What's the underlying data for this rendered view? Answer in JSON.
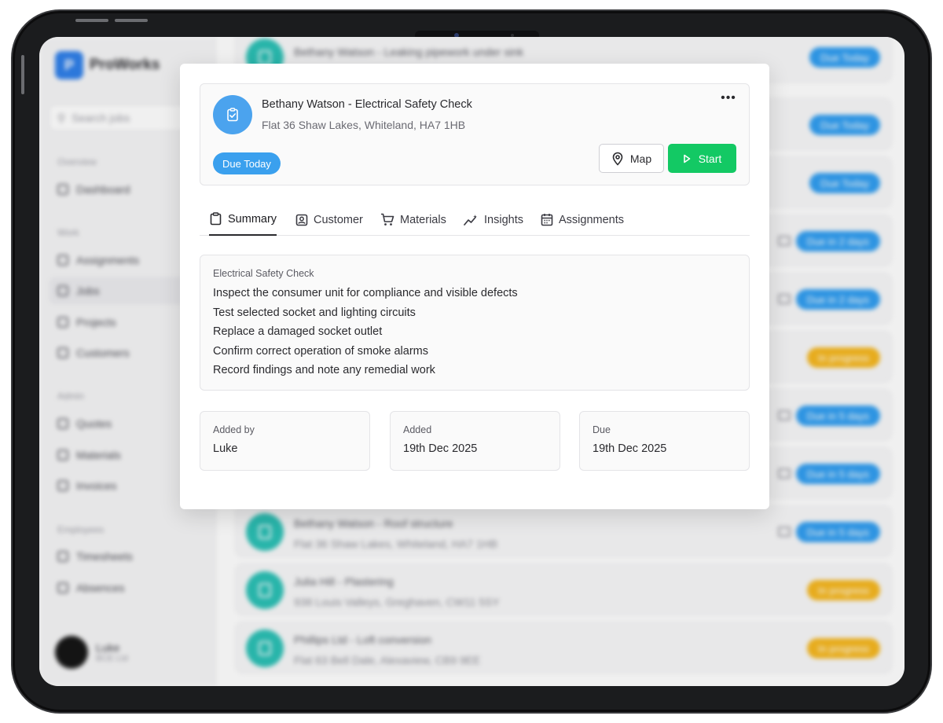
{
  "app": {
    "brand": "ProWorks",
    "search_placeholder": "Search jobs",
    "sidebar": {
      "sections": [
        {
          "label": "Overview",
          "items": [
            "Dashboard"
          ]
        },
        {
          "label": "Work",
          "items": [
            "Assignments",
            "Jobs",
            "Projects",
            "Customers"
          ]
        },
        {
          "label": "Admin",
          "items": [
            "Quotes",
            "Materials",
            "Invoices"
          ]
        },
        {
          "label": "Employees",
          "items": [
            "Timesheets",
            "Absences"
          ]
        }
      ],
      "active_item": "Jobs"
    },
    "user": {
      "name": "Luke",
      "company": "BCE Ltd"
    },
    "jobs": [
      {
        "title": "Bethany Watson - Leaking pipework under sink",
        "address": "",
        "status": "Due Today",
        "status_color": "#2d9cf0"
      },
      {
        "title": "",
        "address": "",
        "status": "Due Today",
        "status_color": "#2d9cf0"
      },
      {
        "title": "",
        "address": "",
        "status": "Due Today",
        "status_color": "#2d9cf0"
      },
      {
        "title": "",
        "address": "",
        "status": "Due in 2 days",
        "status_color": "#2d9cf0"
      },
      {
        "title": "",
        "address": "",
        "status": "Due in 2 days",
        "status_color": "#2d9cf0"
      },
      {
        "title": "",
        "address": "",
        "status": "In progress",
        "status_color": "#f6b61c"
      },
      {
        "title": "",
        "address": "",
        "status": "Due in 5 days",
        "status_color": "#2d9cf0"
      },
      {
        "title": "",
        "address": "",
        "status": "Due in 5 days",
        "status_color": "#2d9cf0"
      },
      {
        "title": "Bethany Watson - Roof structure",
        "address": "Flat 36 Shaw Lakes, Whiteland, HA7 1HB",
        "status": "Due in 5 days",
        "status_color": "#2d9cf0"
      },
      {
        "title": "Julia Hill - Plastering",
        "address": "938 Louis Valleys, Greghaven, CW11 5SY",
        "status": "In progress",
        "status_color": "#f6b61c"
      },
      {
        "title": "Phillips Ltd - Loft conversion",
        "address": "Flat 63 Bell Dale, Alexaview, CB9 9EE",
        "status": "In progress",
        "status_color": "#f6b61c"
      }
    ]
  },
  "modal": {
    "title": "Bethany Watson - Electrical Safety Check",
    "address": "Flat 36 Shaw Lakes, Whiteland, HA7 1HB",
    "more_label": "•••",
    "status_badge": "Due Today",
    "map_label": "Map",
    "start_label": "Start",
    "tabs": [
      {
        "label": "Summary",
        "icon": "clipboard-icon"
      },
      {
        "label": "Customer",
        "icon": "contact-icon"
      },
      {
        "label": "Materials",
        "icon": "cart-icon"
      },
      {
        "label": "Insights",
        "icon": "sparkline-icon"
      },
      {
        "label": "Assignments",
        "icon": "calendar-icon"
      }
    ],
    "active_tab": "Summary",
    "summary": {
      "heading": "Electrical Safety Check",
      "lines": [
        "Inspect the consumer unit for compliance and visible defects",
        "Test selected socket and lighting circuits",
        "Replace a damaged socket outlet",
        "Confirm correct operation of smoke alarms",
        "Record findings and note any remedial work"
      ]
    },
    "details": {
      "added_by_label": "Added by",
      "added_by": "Luke",
      "added_label": "Added",
      "added": "19th Dec 2025",
      "due_label": "Due",
      "due": "19th Dec 2025"
    }
  },
  "colors": {
    "accent_blue": "#3aa0ee",
    "start_green": "#13c964",
    "in_progress": "#f6b61c",
    "job_avatar": "#27bfb4"
  }
}
